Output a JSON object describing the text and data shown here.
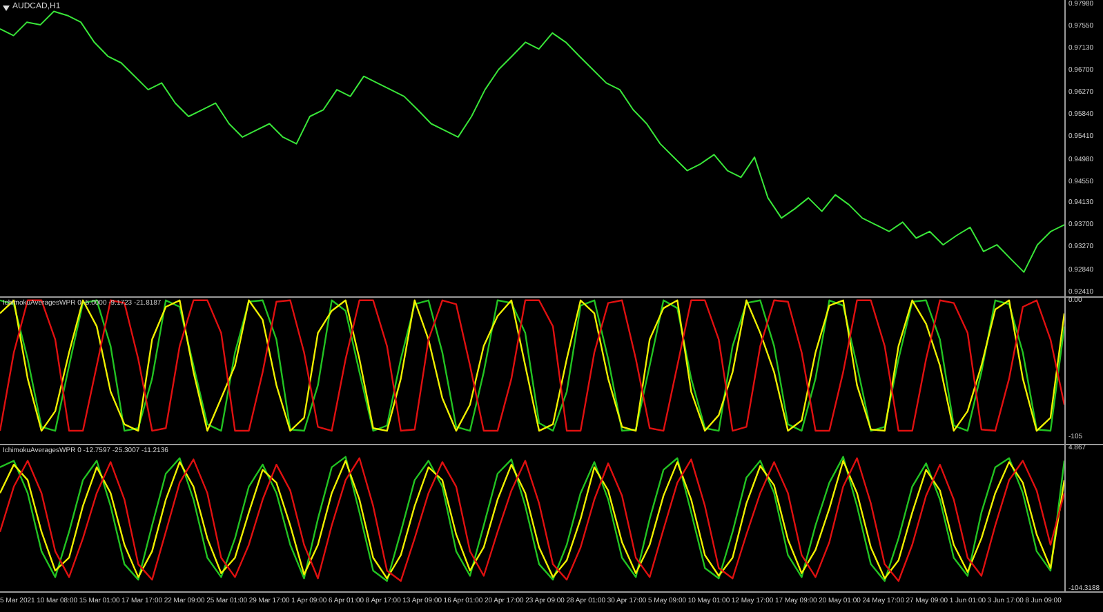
{
  "main_chart": {
    "chart_data": {
      "type": "line",
      "title": "AUDCAD,H1",
      "ylim": [
        0.9232,
        0.9807
      ],
      "yticks": [
        {
          "value": 0.9798,
          "label": "0.97980"
        },
        {
          "value": 0.9755,
          "label": "0.97550"
        },
        {
          "value": 0.9713,
          "label": "0.97130"
        },
        {
          "value": 0.967,
          "label": "0.96700"
        },
        {
          "value": 0.9627,
          "label": "0.96270"
        },
        {
          "value": 0.9584,
          "label": "0.95840"
        },
        {
          "value": 0.9541,
          "label": "0.95410"
        },
        {
          "value": 0.9498,
          "label": "0.94980"
        },
        {
          "value": 0.9455,
          "label": "0.94550"
        },
        {
          "value": 0.9413,
          "label": "0.94130"
        },
        {
          "value": 0.937,
          "label": "0.93700"
        },
        {
          "value": 0.9327,
          "label": "0.93270"
        },
        {
          "value": 0.9284,
          "label": "0.92840"
        },
        {
          "value": 0.9241,
          "label": "0.92410"
        }
      ],
      "series": [
        {
          "color": "#39e639",
          "values": [
            0.9751,
            0.9738,
            0.9764,
            0.9759,
            0.9785,
            0.9777,
            0.9764,
            0.9725,
            0.9698,
            0.9685,
            0.9659,
            0.9633,
            0.9646,
            0.9607,
            0.9581,
            0.9594,
            0.9607,
            0.9567,
            0.9541,
            0.9554,
            0.9567,
            0.9541,
            0.9528,
            0.9581,
            0.9594,
            0.9633,
            0.962,
            0.9659,
            0.9646,
            0.9633,
            0.962,
            0.9594,
            0.9567,
            0.9554,
            0.9541,
            0.9581,
            0.9633,
            0.9672,
            0.9698,
            0.9725,
            0.9712,
            0.9743,
            0.9725,
            0.9698,
            0.9672,
            0.9646,
            0.9633,
            0.9594,
            0.9567,
            0.9528,
            0.9502,
            0.9476,
            0.9489,
            0.9507,
            0.9476,
            0.9463,
            0.9502,
            0.9423,
            0.9384,
            0.9402,
            0.9423,
            0.9397,
            0.9429,
            0.941,
            0.9384,
            0.9371,
            0.9358,
            0.9376,
            0.9345,
            0.9358,
            0.9332,
            0.935,
            0.9366,
            0.9319,
            0.9332,
            0.9305,
            0.9279,
            0.9332,
            0.9358,
            0.9371
          ]
        }
      ]
    }
  },
  "indicator_panes": [
    {
      "title": "IchimokuAveragesWPR 0 -5.0000 -9.1723 -21.8187",
      "chart_data": {
        "type": "line",
        "ylim": [
          -110,
          2
        ],
        "yticks": [
          {
            "value": 0,
            "label": "0.00"
          },
          {
            "value": -105,
            "label": "-105"
          }
        ],
        "series": [
          {
            "color": "#22c322",
            "values": [
              0,
              -3,
              -45,
              -97,
              -100,
              -50,
              -2,
              0,
              -35,
              -100,
              -98,
              -60,
              0,
              -5,
              -50,
              -95,
              -100,
              -40,
              -1,
              0,
              -30,
              -99,
              -100,
              -65,
              0,
              -8,
              -55,
              -100,
              -96,
              -45,
              -3,
              0,
              -40,
              -97,
              -100,
              -55,
              0,
              -2,
              -25,
              -94,
              -100,
              -70,
              -4,
              0,
              -45,
              -100,
              -99,
              -50,
              0,
              -6,
              -60,
              -98,
              -100,
              -35,
              -2,
              0,
              -35,
              -95,
              -100,
              -60,
              0,
              -4,
              -50,
              -100,
              -97,
              -45,
              -1,
              0,
              -30,
              -96,
              -100,
              -55,
              0,
              -3,
              -40,
              -99,
              -100,
              -20
            ]
          },
          {
            "color": "#f0f000",
            "values": [
              -10,
              0,
              -60,
              -100,
              -85,
              -40,
              0,
              -20,
              -70,
              -95,
              -100,
              -30,
              -5,
              0,
              -55,
              -100,
              -75,
              -50,
              0,
              -15,
              -65,
              -100,
              -90,
              -25,
              -8,
              0,
              -45,
              -98,
              -100,
              -60,
              0,
              -30,
              -75,
              -100,
              -80,
              -35,
              -12,
              0,
              -50,
              -100,
              -95,
              -45,
              0,
              -10,
              -60,
              -97,
              -100,
              -30,
              -6,
              0,
              -70,
              -100,
              -88,
              -55,
              0,
              -25,
              -55,
              -100,
              -92,
              -40,
              -4,
              0,
              -65,
              -99,
              -100,
              -35,
              0,
              -18,
              -50,
              -100,
              -85,
              -50,
              -7,
              0,
              -60,
              -100,
              -90,
              -10
            ]
          },
          {
            "color": "#e01010",
            "values": [
              -100,
              -40,
              0,
              0,
              -30,
              -100,
              -100,
              -50,
              0,
              -2,
              -45,
              -100,
              -98,
              -35,
              0,
              0,
              -25,
              -100,
              -100,
              -55,
              -1,
              0,
              -40,
              -97,
              -100,
              -45,
              0,
              0,
              -35,
              -100,
              -99,
              -30,
              0,
              -3,
              -50,
              -100,
              -100,
              -60,
              0,
              0,
              -20,
              -100,
              -100,
              -40,
              -2,
              0,
              -45,
              -98,
              -100,
              -50,
              0,
              0,
              -30,
              -100,
              -97,
              -35,
              0,
              -1,
              -40,
              -100,
              -100,
              -55,
              0,
              0,
              -35,
              -100,
              -100,
              -45,
              0,
              -2,
              -25,
              -99,
              -100,
              -60,
              -5,
              0,
              -30,
              -80
            ]
          }
        ]
      }
    },
    {
      "title": "IchimokuAveragesWPR 0 -12.7597 -25.3007 -11.2136",
      "chart_data": {
        "type": "line",
        "ylim": [
          -106,
          7
        ],
        "yticks": [
          {
            "value": 4.867,
            "label": "4.867"
          },
          {
            "value": -104.3188,
            "label": "-104.3188"
          }
        ],
        "series": [
          {
            "color": "#22c322",
            "values": [
              -10,
              -5,
              -30,
              -75,
              -95,
              -60,
              -20,
              -5,
              -40,
              -85,
              -97,
              -55,
              -15,
              -3,
              -35,
              -80,
              -95,
              -65,
              -25,
              -8,
              -30,
              -70,
              -96,
              -50,
              -10,
              -2,
              -45,
              -90,
              -98,
              -60,
              -20,
              -5,
              -25,
              -75,
              -94,
              -55,
              -15,
              -4,
              -40,
              -85,
              -97,
              -70,
              -30,
              -6,
              -35,
              -80,
              -95,
              -50,
              -12,
              -3,
              -45,
              -88,
              -96,
              -60,
              -18,
              -5,
              -30,
              -78,
              -95,
              -55,
              -22,
              -2,
              -40,
              -85,
              -98,
              -65,
              -25,
              -7,
              -35,
              -80,
              -94,
              -45,
              -10,
              -3,
              -30,
              -75,
              -90,
              -5
            ]
          },
          {
            "color": "#f0f000",
            "values": [
              -30,
              -8,
              -20,
              -60,
              -90,
              -80,
              -40,
              -10,
              -30,
              -70,
              -95,
              -75,
              -35,
              -6,
              -25,
              -65,
              -92,
              -80,
              -45,
              -12,
              -22,
              -55,
              -93,
              -70,
              -30,
              -5,
              -35,
              -80,
              -96,
              -78,
              -40,
              -10,
              -20,
              -62,
              -90,
              -72,
              -35,
              -8,
              -30,
              -72,
              -95,
              -82,
              -50,
              -10,
              -28,
              -68,
              -92,
              -70,
              -32,
              -6,
              -35,
              -78,
              -94,
              -80,
              -38,
              -9,
              -24,
              -66,
              -92,
              -74,
              -42,
              -5,
              -30,
              -72,
              -96,
              -82,
              -45,
              -12,
              -28,
              -70,
              -91,
              -65,
              -30,
              -6,
              -22,
              -62,
              -88,
              -20
            ]
          },
          {
            "color": "#e01010",
            "values": [
              -60,
              -25,
              -5,
              -30,
              -75,
              -95,
              -65,
              -30,
              -6,
              -35,
              -85,
              -97,
              -60,
              -22,
              -4,
              -30,
              -80,
              -95,
              -70,
              -35,
              -8,
              -28,
              -70,
              -96,
              -55,
              -20,
              -3,
              -40,
              -90,
              -98,
              -65,
              -30,
              -6,
              -25,
              -75,
              -94,
              -60,
              -28,
              -5,
              -38,
              -85,
              -97,
              -72,
              -35,
              -7,
              -32,
              -80,
              -95,
              -58,
              -22,
              -4,
              -40,
              -88,
              -96,
              -62,
              -30,
              -6,
              -30,
              -78,
              -95,
              -68,
              -25,
              -3,
              -38,
              -85,
              -98,
              -70,
              -32,
              -8,
              -35,
              -80,
              -94,
              -55,
              -20,
              -5,
              -28,
              -70,
              -30
            ]
          }
        ]
      }
    }
  ],
  "time_axis": [
    "5 Mar 2021",
    "10 Mar 08:00",
    "15 Mar 01:00",
    "17 Mar 17:00",
    "22 Mar 09:00",
    "25 Mar 01:00",
    "29 Mar 17:00",
    "1 Apr 09:00",
    "6 Apr 01:00",
    "8 Apr 17:00",
    "13 Apr 09:00",
    "16 Apr 01:00",
    "20 Apr 17:00",
    "23 Apr 09:00",
    "28 Apr 01:00",
    "30 Apr 17:00",
    "5 May 09:00",
    "10 May 01:00",
    "12 May 17:00",
    "17 May 09:00",
    "20 May 01:00",
    "24 May 17:00",
    "27 May 09:00",
    "1 Jun 01:00",
    "3 Jun 17:00",
    "8 Jun 09:00"
  ]
}
